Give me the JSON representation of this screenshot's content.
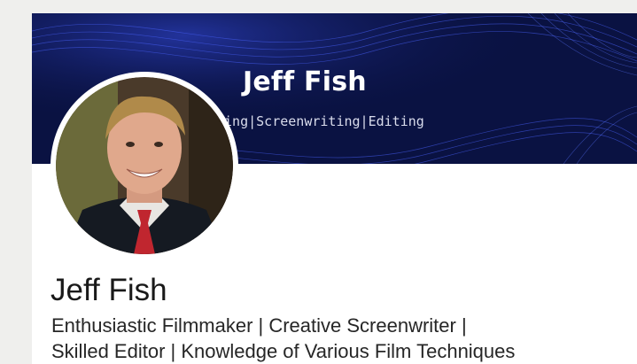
{
  "profile": {
    "banner": {
      "name": "Jeff Fish",
      "tagline": "king|Screenwriting|Editing",
      "background_color": "#0a1242",
      "accent_color": "#3b4fd8"
    },
    "avatar": {
      "icon": "profile-photo"
    },
    "name": "Jeff Fish",
    "headline_lines": [
      "Enthusiastic Filmmaker | Creative Screenwriter |",
      "Skilled Editor | Knowledge of Various Film Techniques"
    ]
  }
}
